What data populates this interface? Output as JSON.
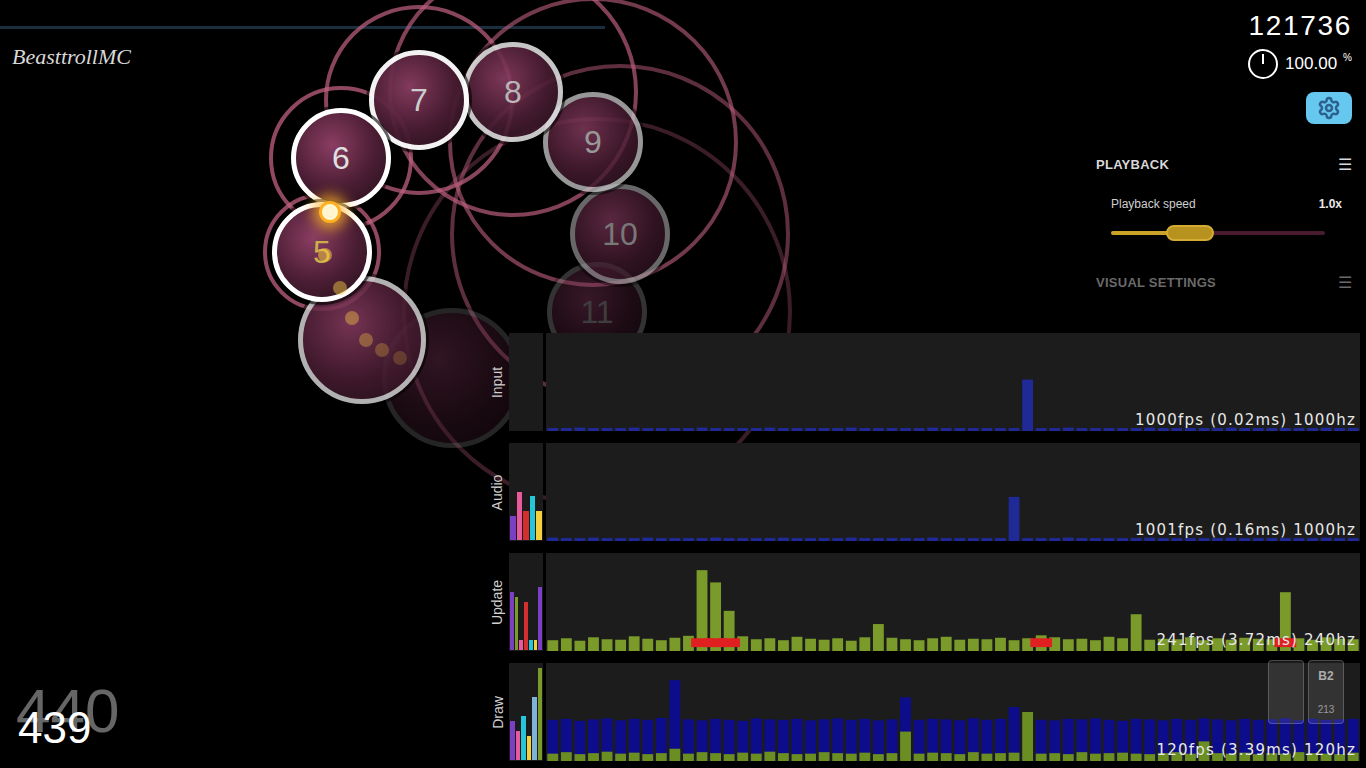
{
  "player": {
    "name": "BeasttrollMC"
  },
  "song_progress": {
    "level": 0.443
  },
  "score": "121736",
  "accuracy": {
    "value": "100.00",
    "unit": "%"
  },
  "hit_objects": [
    {
      "number": "5",
      "kind": "circle"
    },
    {
      "number": "6",
      "kind": "circle"
    },
    {
      "number": "7",
      "kind": "circle"
    },
    {
      "number": "8",
      "kind": "circle"
    },
    {
      "number": "9",
      "kind": "circle"
    },
    {
      "number": "10",
      "kind": "circle"
    },
    {
      "number": "11",
      "kind": "circle"
    },
    {
      "number": "",
      "kind": "slider-head"
    },
    {
      "number": "",
      "kind": "slider-head"
    }
  ],
  "combo": {
    "previous": "440",
    "current": "439"
  },
  "settings_panel": {
    "sections": [
      {
        "title": "PLAYBACK",
        "menu": "☰",
        "expanded": true,
        "rows": [
          {
            "label": "Playback speed",
            "value": "1.0x",
            "level": 0.37
          }
        ]
      },
      {
        "title": "VISUAL SETTINGS",
        "menu": "☰",
        "expanded": false,
        "rows": []
      }
    ]
  },
  "key_counters": [
    {
      "label": "B2",
      "count": "213"
    }
  ],
  "frame_graphs": [
    {
      "label": "Input",
      "readout": "1000fps (0.02ms) 1000hz",
      "mini_bars": [],
      "markers": [],
      "series": [
        {
          "color": "#1f2a96",
          "values": [
            0.6,
            0.6,
            0.7,
            0.6,
            0.6,
            0.6,
            0.7,
            0.6,
            0.6,
            0.6,
            0.6,
            0.7,
            0.6,
            0.6,
            0.6,
            0.6,
            0.7,
            0.6,
            0.6,
            0.6,
            0.6,
            0.6,
            0.7,
            0.6,
            0.6,
            0.6,
            0.6,
            0.6,
            0.7,
            0.6,
            0.6,
            0.6,
            0.6,
            0.6,
            0.6,
            10.5,
            0.6,
            0.6,
            0.7,
            0.6,
            0.6,
            0.6,
            0.6,
            0.6,
            0.7,
            0.6,
            0.6,
            0.6,
            0.6,
            0.6,
            0.7,
            0.6,
            0.6,
            0.6,
            0.6,
            0.6,
            0.6,
            0.7,
            0.6,
            0.6
          ]
        }
      ]
    },
    {
      "label": "Audio",
      "readout": "1001fps (0.16ms) 1000hz",
      "mini_bars": [
        {
          "value": 0.25,
          "color": "#7b3fc4"
        },
        {
          "value": 0.5,
          "color": "#e85a9c"
        },
        {
          "value": 0.3,
          "color": "#d32f2f"
        },
        {
          "value": 0.45,
          "color": "#26c6da"
        },
        {
          "value": 0.3,
          "color": "#f4d03f"
        }
      ],
      "markers": [],
      "series": [
        {
          "color": "#1f2a96",
          "values": [
            0.7,
            0.6,
            0.6,
            0.7,
            0.6,
            0.6,
            0.6,
            0.7,
            0.6,
            0.6,
            0.6,
            0.6,
            0.7,
            0.6,
            0.6,
            0.6,
            0.6,
            0.7,
            0.6,
            0.6,
            0.6,
            0.6,
            0.7,
            0.6,
            0.6,
            0.6,
            0.6,
            0.6,
            0.7,
            0.6,
            0.6,
            0.6,
            0.6,
            0.6,
            9.0,
            0.6,
            0.6,
            0.6,
            0.7,
            0.6,
            0.6,
            0.6,
            0.6,
            0.6,
            0.7,
            0.6,
            0.6,
            0.6,
            0.6,
            0.6,
            0.7,
            0.6,
            0.6,
            0.6,
            0.6,
            0.6,
            0.6,
            0.7,
            0.6,
            0.6
          ]
        }
      ]
    },
    {
      "label": "Update",
      "readout": "241fps (3.72ms) 240hz",
      "mini_bars": [
        {
          "value": 0.6,
          "color": "#7b3fc4"
        },
        {
          "value": 0.55,
          "color": "#7a9a2a"
        },
        {
          "value": 0.1,
          "color": "#e85a9c"
        },
        {
          "value": 0.5,
          "color": "#d32f2f"
        },
        {
          "value": 0.1,
          "color": "#26c6da"
        },
        {
          "value": 0.1,
          "color": "#f4d03f"
        },
        {
          "value": 0.65,
          "color": "#7b3fc4"
        }
      ],
      "markers": [
        11,
        12,
        13,
        36,
        54
      ],
      "series": [
        {
          "color": "#7a9a2a",
          "values": [
            2.2,
            2.6,
            2.1,
            2.8,
            2.4,
            2.3,
            3.0,
            2.5,
            2.2,
            2.7,
            3.1,
            16.5,
            14.0,
            8.2,
            3.0,
            2.4,
            2.6,
            2.2,
            2.9,
            2.5,
            2.3,
            2.6,
            2.1,
            2.8,
            5.5,
            2.7,
            2.4,
            2.2,
            2.6,
            2.9,
            2.3,
            2.5,
            2.4,
            2.7,
            2.2,
            2.6,
            3.2,
            2.8,
            2.4,
            2.5,
            2.2,
            2.9,
            2.6,
            7.5,
            2.3,
            2.5,
            2.4,
            2.8,
            2.2,
            2.6,
            2.3,
            2.7,
            2.5,
            2.4,
            12.0,
            2.6,
            2.3,
            2.8,
            2.5,
            2.4
          ]
        }
      ]
    },
    {
      "label": "Draw",
      "readout": "120fps (3.39ms) 120hz",
      "mini_bars": [
        {
          "value": 0.4,
          "color": "#7b3fc4"
        },
        {
          "value": 0.3,
          "color": "#e85a9c"
        },
        {
          "value": 0.45,
          "color": "#26c6da"
        },
        {
          "value": 0.25,
          "color": "#f4d03f"
        },
        {
          "value": 0.65,
          "color": "#7fb3d5"
        },
        {
          "value": 0.95,
          "color": "#7a9a2a"
        }
      ],
      "markers": [],
      "series": [
        {
          "color": "#0d0d8c",
          "values": [
            8.4,
            8.6,
            8.2,
            8.5,
            8.7,
            8.3,
            8.6,
            8.4,
            8.8,
            16.5,
            8.5,
            8.3,
            8.6,
            8.4,
            8.2,
            8.7,
            8.5,
            8.4,
            8.6,
            8.3,
            8.5,
            8.7,
            8.4,
            8.6,
            8.3,
            8.5,
            13.0,
            8.4,
            8.6,
            8.5,
            8.3,
            8.7,
            8.4,
            8.6,
            11.0,
            8.5,
            8.4,
            8.3,
            8.6,
            8.5,
            8.7,
            8.4,
            8.2,
            8.6,
            8.5,
            8.3,
            8.6,
            8.4,
            8.7,
            8.5,
            8.3,
            8.6,
            8.4,
            8.5,
            8.7,
            8.3,
            8.6,
            8.4,
            8.5,
            8.6
          ]
        },
        {
          "color": "#6b8e23",
          "values": [
            1.5,
            1.8,
            1.4,
            1.6,
            1.9,
            1.5,
            1.7,
            1.4,
            1.6,
            2.5,
            1.5,
            1.8,
            1.6,
            1.4,
            1.7,
            1.5,
            1.9,
            1.6,
            1.4,
            1.5,
            1.8,
            1.6,
            1.5,
            1.7,
            1.4,
            1.6,
            6.0,
            1.5,
            1.7,
            1.6,
            1.4,
            1.8,
            1.5,
            1.6,
            1.7,
            10.0,
            1.5,
            1.6,
            1.4,
            1.8,
            1.5,
            1.6,
            1.7,
            1.5,
            1.4,
            1.6,
            1.8,
            1.5,
            4.0,
            1.6,
            1.5,
            1.7,
            1.4,
            1.6,
            1.5,
            1.8,
            1.6,
            1.5,
            1.4,
            1.7
          ]
        }
      ]
    }
  ]
}
